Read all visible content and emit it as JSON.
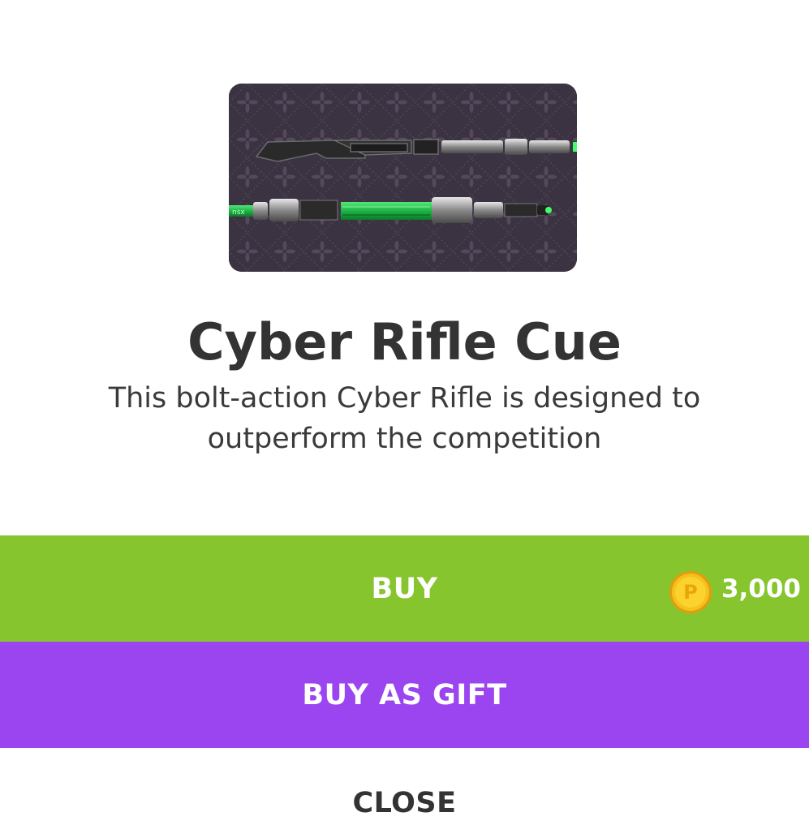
{
  "item": {
    "title": "Cyber Rifle Cue",
    "description": "This bolt-action Cyber Rifle is designed to outperform the competition",
    "image_icon": "cue-image"
  },
  "buy": {
    "label": "BUY",
    "price": "3,000",
    "coin_icon": "coin-icon",
    "coin_glyph": "P",
    "color": "#87c52e"
  },
  "gift": {
    "label": "BUY AS GIFT",
    "color": "#9b45f0"
  },
  "close": {
    "label": "CLOSE"
  }
}
